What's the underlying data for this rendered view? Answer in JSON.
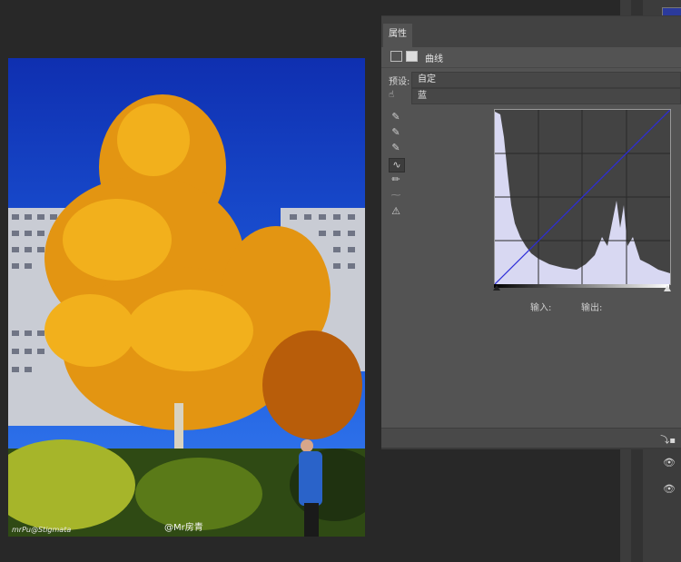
{
  "panel": {
    "tab_label": "属性",
    "header_title": "曲线",
    "preset_label": "预设:",
    "preset_value": "自定",
    "channel_value": "蓝",
    "input_label": "输入:",
    "output_label": "输出:"
  },
  "photo": {
    "watermark_left": "mrPu@Stigmata",
    "watermark_mid": "@Mr房青"
  },
  "icons": {
    "curves_layer": "curves-icon",
    "mask": "mask-icon",
    "hand_target": "target-adjust-icon",
    "eyedropper_black": "eyedropper-icon",
    "eyedropper_gray": "eyedropper-icon",
    "eyedropper_white": "eyedropper-icon",
    "curve_tool": "curve-edit-icon",
    "pencil_tool": "pencil-icon",
    "smooth_tool": "smooth-icon",
    "clip_warning": "clipping-warning-icon",
    "eye": "eye-icon"
  },
  "colors": {
    "panel_bg": "#535353",
    "curve_line": "#2d2dd8",
    "histogram_fill": "#d8d8f2"
  }
}
